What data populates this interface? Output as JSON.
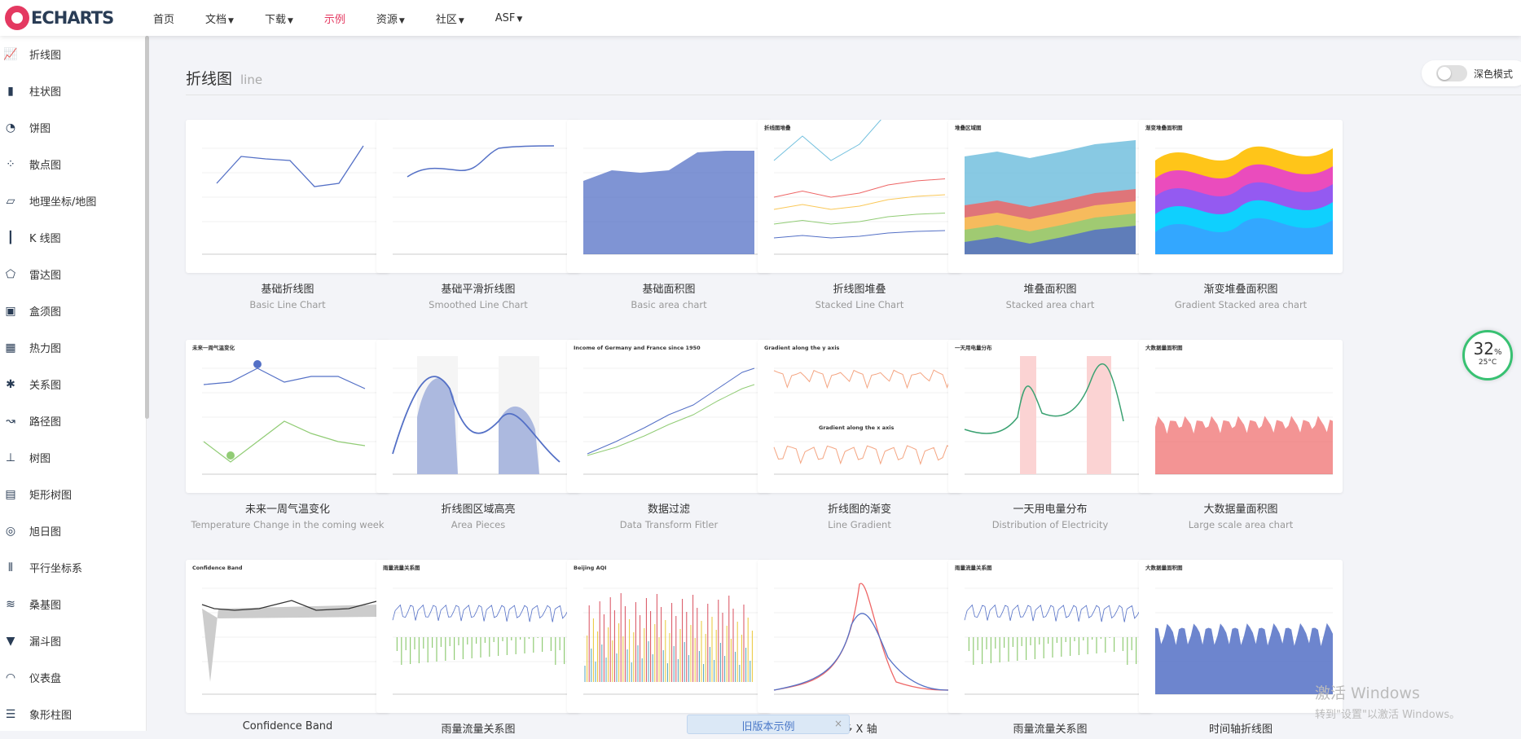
{
  "app": {
    "logo_text": "ECHARTS"
  },
  "nav": [
    {
      "label": "首页",
      "dropdown": false,
      "active": false
    },
    {
      "label": "文档",
      "dropdown": true,
      "active": false
    },
    {
      "label": "下载",
      "dropdown": true,
      "active": false
    },
    {
      "label": "示例",
      "dropdown": false,
      "active": true
    },
    {
      "label": "资源",
      "dropdown": true,
      "active": false
    },
    {
      "label": "社区",
      "dropdown": true,
      "active": false
    },
    {
      "label": "ASF",
      "dropdown": true,
      "active": false
    }
  ],
  "sidebar": [
    {
      "label": "折线图",
      "icon": "line-chart-icon"
    },
    {
      "label": "柱状图",
      "icon": "bar-chart-icon"
    },
    {
      "label": "饼图",
      "icon": "pie-chart-icon"
    },
    {
      "label": "散点图",
      "icon": "scatter-chart-icon"
    },
    {
      "label": "地理坐标/地图",
      "icon": "map-icon"
    },
    {
      "label": "K 线图",
      "icon": "candlestick-icon"
    },
    {
      "label": "雷达图",
      "icon": "radar-icon"
    },
    {
      "label": "盒须图",
      "icon": "boxplot-icon"
    },
    {
      "label": "热力图",
      "icon": "heatmap-icon"
    },
    {
      "label": "关系图",
      "icon": "graph-icon"
    },
    {
      "label": "路径图",
      "icon": "lines-icon"
    },
    {
      "label": "树图",
      "icon": "tree-icon"
    },
    {
      "label": "矩形树图",
      "icon": "treemap-icon"
    },
    {
      "label": "旭日图",
      "icon": "sunburst-icon"
    },
    {
      "label": "平行坐标系",
      "icon": "parallel-icon"
    },
    {
      "label": "桑基图",
      "icon": "sankey-icon"
    },
    {
      "label": "漏斗图",
      "icon": "funnel-icon"
    },
    {
      "label": "仪表盘",
      "icon": "gauge-icon"
    },
    {
      "label": "象形柱图",
      "icon": "pictorial-bar-icon"
    }
  ],
  "page": {
    "title": "折线图",
    "subtitle": "line",
    "dark_mode_label": "深色模式"
  },
  "cards": [
    {
      "cn": "基础折线图",
      "en": "Basic Line Chart",
      "kind": "basic-line",
      "caption": ""
    },
    {
      "cn": "基础平滑折线图",
      "en": "Smoothed Line Chart",
      "kind": "smooth-line",
      "caption": ""
    },
    {
      "cn": "基础面积图",
      "en": "Basic area chart",
      "kind": "basic-area",
      "caption": ""
    },
    {
      "cn": "折线图堆叠",
      "en": "Stacked Line Chart",
      "kind": "stacked-line",
      "caption": "折线图堆叠"
    },
    {
      "cn": "堆叠面积图",
      "en": "Stacked area chart",
      "kind": "stacked-area",
      "caption": "堆叠区域图"
    },
    {
      "cn": "渐变堆叠面积图",
      "en": "Gradient Stacked area chart",
      "kind": "gradient-stacked",
      "caption": "渐变堆叠面积图"
    },
    {
      "cn": "未来一周气温变化",
      "en": "Temperature Change in the coming week",
      "kind": "temperature",
      "caption": "未来一周气温变化"
    },
    {
      "cn": "折线图区域高亮",
      "en": "Area Pieces",
      "kind": "area-pieces",
      "caption": ""
    },
    {
      "cn": "数据过滤",
      "en": "Data Transform Fitler",
      "kind": "transform",
      "caption": "Income of Germany and France since 1950"
    },
    {
      "cn": "折线图的渐变",
      "en": "Line Gradient",
      "kind": "gradient-line",
      "caption": "Gradient along the y axis"
    },
    {
      "cn": "一天用电量分布",
      "en": "Distribution of Electricity",
      "kind": "electricity",
      "caption": "一天用电量分布"
    },
    {
      "cn": "大数据量面积图",
      "en": "Large scale area chart",
      "kind": "large-area",
      "caption": "大数据量面积图"
    },
    {
      "cn": "Confidence Band",
      "en": "",
      "kind": "confidence",
      "caption": "Confidence Band"
    },
    {
      "cn": "雨量流量关系图",
      "en": "",
      "kind": "rain",
      "caption": "雨量流量关系图"
    },
    {
      "cn": "",
      "en": "",
      "kind": "aqi",
      "caption": "Beijing AQI"
    },
    {
      "cn": "多 X 轴",
      "en": "",
      "kind": "multi-x",
      "caption": ""
    },
    {
      "cn": "雨量流量关系图",
      "en": "",
      "kind": "rain2",
      "caption": "雨量流量关系图"
    },
    {
      "cn": "时间轴折线图",
      "en": "",
      "kind": "time-line",
      "caption": "大数据量面积图"
    }
  ],
  "perf_widget": {
    "percent": "32",
    "percent_unit": "%",
    "temp": "25°C"
  },
  "old_version_button": {
    "label": "旧版本示例",
    "close": "×"
  },
  "watermark": {
    "line1": "激活 Windows",
    "line2": "转到\"设置\"以激活 Windows。"
  },
  "colors": {
    "accent": "#e43961",
    "series_blue": "#5470c6",
    "series_green": "#91cc75"
  }
}
